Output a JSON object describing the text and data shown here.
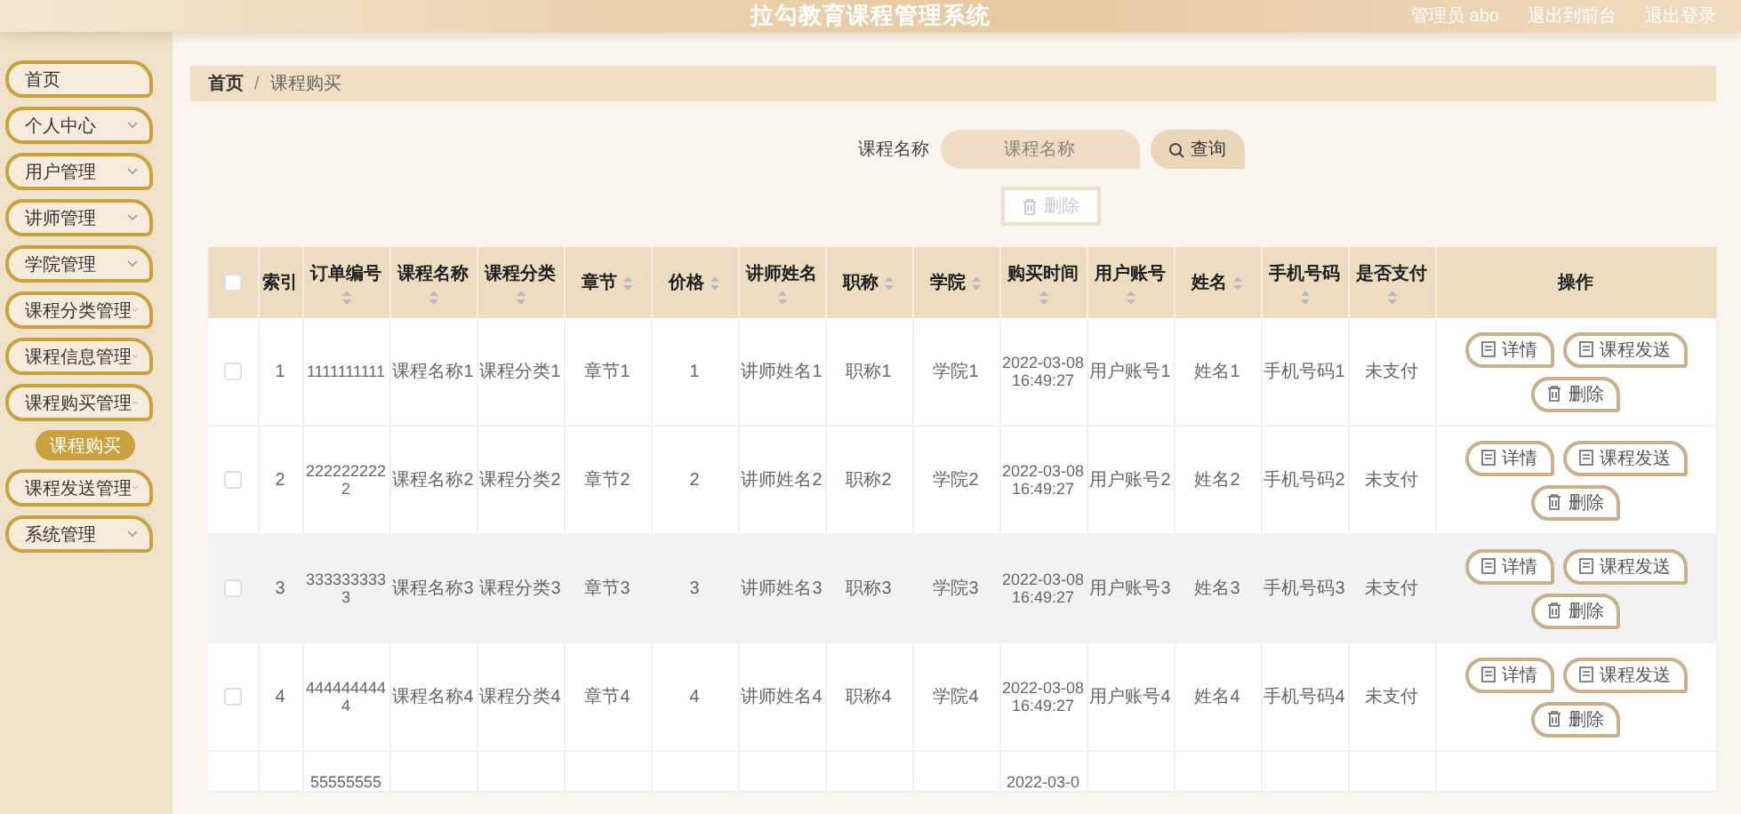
{
  "header": {
    "title": "拉勾教育课程管理系统",
    "links": [
      "管理员 abo",
      "退出到前台",
      "退出登录"
    ]
  },
  "sidebar": {
    "items": [
      {
        "label": "首页",
        "kind": "link"
      },
      {
        "label": "个人中心",
        "kind": "group",
        "expanded": false
      },
      {
        "label": "用户管理",
        "kind": "group",
        "expanded": false
      },
      {
        "label": "讲师管理",
        "kind": "group",
        "expanded": false
      },
      {
        "label": "学院管理",
        "kind": "group",
        "expanded": false
      },
      {
        "label": "课程分类管理",
        "kind": "group",
        "expanded": false
      },
      {
        "label": "课程信息管理",
        "kind": "group",
        "expanded": false
      },
      {
        "label": "课程购买管理",
        "kind": "group",
        "expanded": true,
        "children": [
          {
            "label": "课程购买",
            "selected": true
          }
        ]
      },
      {
        "label": "课程发送管理",
        "kind": "group",
        "expanded": false
      },
      {
        "label": "系统管理",
        "kind": "group",
        "expanded": false
      }
    ]
  },
  "breadcrumb": {
    "items": [
      "首页",
      "课程购买"
    ],
    "separator": "/"
  },
  "search": {
    "label": "课程名称",
    "placeholder": "课程名称",
    "button": "查询"
  },
  "toolbar": {
    "delete_button": "删除",
    "disabled": true
  },
  "table": {
    "select_all_checked": false,
    "columns": [
      {
        "label": "索引",
        "sortable": false
      },
      {
        "label": "订单编号",
        "sortable": true
      },
      {
        "label": "课程名称",
        "sortable": true
      },
      {
        "label": "课程分类",
        "sortable": true
      },
      {
        "label": "章节",
        "sortable": true
      },
      {
        "label": "价格",
        "sortable": true
      },
      {
        "label": "讲师姓名",
        "sortable": true
      },
      {
        "label": "职称",
        "sortable": true
      },
      {
        "label": "学院",
        "sortable": true
      },
      {
        "label": "购买时间",
        "sortable": true
      },
      {
        "label": "用户账号",
        "sortable": true
      },
      {
        "label": "姓名",
        "sortable": true
      },
      {
        "label": "手机号码",
        "sortable": true
      },
      {
        "label": "是否支付",
        "sortable": true
      },
      {
        "label": "操作",
        "sortable": false
      }
    ],
    "rows": [
      {
        "checked": false,
        "highlighted": false,
        "cells": [
          "1",
          "1111111111",
          "课程名称1",
          "课程分类1",
          "章节1",
          "1",
          "讲师姓名1",
          "职称1",
          "学院1",
          "2022-03-08 16:49:27",
          "用户账号1",
          "姓名1",
          "手机号码1",
          "未支付"
        ],
        "actions": [
          "详情",
          "课程发送",
          "删除"
        ]
      },
      {
        "checked": false,
        "highlighted": false,
        "cells": [
          "2",
          "2222222222",
          "课程名称2",
          "课程分类2",
          "章节2",
          "2",
          "讲师姓名2",
          "职称2",
          "学院2",
          "2022-03-08 16:49:27",
          "用户账号2",
          "姓名2",
          "手机号码2",
          "未支付"
        ],
        "actions": [
          "详情",
          "课程发送",
          "删除"
        ]
      },
      {
        "checked": false,
        "highlighted": true,
        "cells": [
          "3",
          "3333333333",
          "课程名称3",
          "课程分类3",
          "章节3",
          "3",
          "讲师姓名3",
          "职称3",
          "学院3",
          "2022-03-08 16:49:27",
          "用户账号3",
          "姓名3",
          "手机号码3",
          "未支付"
        ],
        "actions": [
          "详情",
          "课程发送",
          "删除"
        ]
      },
      {
        "checked": false,
        "highlighted": false,
        "cells": [
          "4",
          "4444444444",
          "课程名称4",
          "课程分类4",
          "章节4",
          "4",
          "讲师姓名4",
          "职称4",
          "学院4",
          "2022-03-08 16:49:27",
          "用户账号4",
          "姓名4",
          "手机号码4",
          "未支付"
        ],
        "actions": [
          "详情",
          "课程发送",
          "删除"
        ]
      },
      {
        "highlighted": false,
        "partial": true,
        "cells": [
          null,
          "55555555",
          null,
          null,
          null,
          null,
          null,
          null,
          null,
          "2022-03-0",
          null,
          null,
          null,
          null
        ]
      }
    ]
  }
}
